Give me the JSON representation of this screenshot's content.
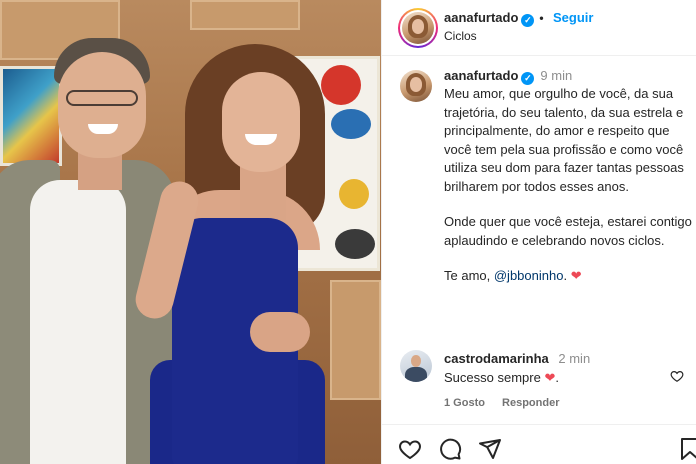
{
  "header": {
    "username": "aanafurtado",
    "follow_label": "Seguir",
    "subtitle": "Ciclos",
    "dot": "•"
  },
  "post": {
    "username": "aanafurtado",
    "time": "9 min",
    "caption": {
      "paragraph1": "Meu amor, que orgulho de você, da sua trajetória, do seu talento, da sua estrela e principalmente, do amor e respeito que você tem pela sua profissão e como você utiliza seu dom para fazer tantas pessoas brilharem por todos esses anos.",
      "paragraph2": "Onde quer que você esteja, estarei contigo aplaudindo e celebrando novos ciclos.",
      "paragraph3_prefix": "Te amo, ",
      "mention": "@jbboninho",
      "paragraph3_suffix": ". "
    }
  },
  "comment": {
    "username": "castrodamarinha",
    "time": "2 min",
    "text": "Sucesso sempre ",
    "likes_label": "1 Gosto",
    "reply_label": "Responder"
  },
  "icons": {
    "verified": "verified-badge",
    "heart_emoji": "red-heart",
    "like": "heart-outline",
    "comment": "comment-bubble",
    "share": "paper-plane",
    "save": "bookmark"
  },
  "colors": {
    "accent": "#0095f6",
    "heart": "#ed4956",
    "mention": "#00376b"
  }
}
